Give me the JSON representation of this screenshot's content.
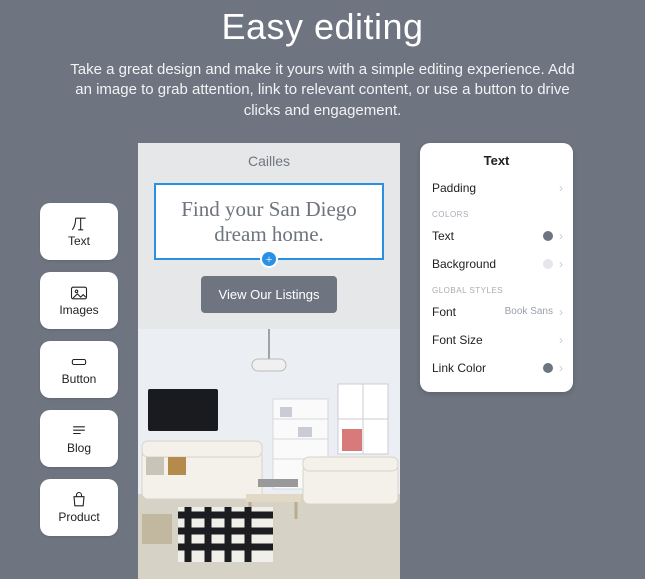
{
  "hero": {
    "title": "Easy editing",
    "body": "Take a great design and make it yours with a simple editing experience. Add an image to grab attention, link to relevant content, or use a button to drive clicks and engagement."
  },
  "palette": [
    {
      "id": "text",
      "label": "Text"
    },
    {
      "id": "images",
      "label": "Images"
    },
    {
      "id": "button",
      "label": "Button"
    },
    {
      "id": "blog",
      "label": "Blog"
    },
    {
      "id": "product",
      "label": "Product"
    }
  ],
  "preview": {
    "brand": "Cailles",
    "headline": "Find your San Diego dream home.",
    "cta_label": "View Our Listings"
  },
  "panel": {
    "title": "Text",
    "rows": {
      "padding": "Padding",
      "text_color": "Text",
      "background": "Background",
      "font": "Font",
      "font_value": "Book Sans",
      "font_size": "Font Size",
      "link_color": "Link Color"
    },
    "sections": {
      "colors": "Colors",
      "global_styles": "Global Styles"
    }
  },
  "colors": {
    "text_swatch": "#6f7580",
    "bg_swatch": "#e4e6ea",
    "link_swatch": "#6f7580"
  }
}
